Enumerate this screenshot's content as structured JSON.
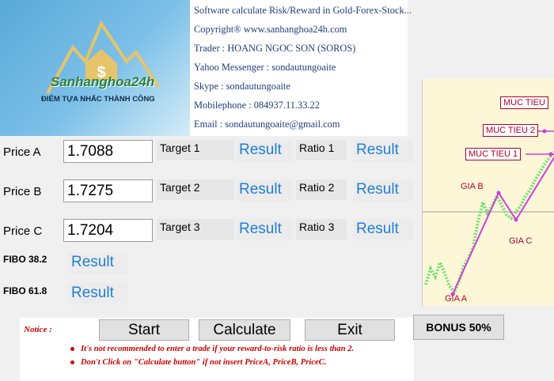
{
  "header": {
    "logo": {
      "brand": "Sanhanghoa24h",
      "slogan": "ĐIỂM TỰA NHẤC THÀNH CÔNG",
      "icon": "dollar-house-mountain-logo"
    },
    "info_lines": [
      "Software calculate Risk/Reward in  Gold-Forex-Stock...",
      "Copyright® www.sanhanghoa24h.com",
      "Trader : HOANG NGOC SON (SOROS)",
      "Yahoo Messenger : sondautungoaite",
      "Skype : sondautungoaite",
      "Mobilephone : 084937.11.33.22",
      "Email : sondautungoaite@gmail.com"
    ]
  },
  "inputs": {
    "price_a": {
      "label": "Price A",
      "value": "1.7088"
    },
    "price_b": {
      "label": "Price B",
      "value": "1.7275"
    },
    "price_c": {
      "label": "Price C",
      "value": "1.7204"
    }
  },
  "targets": [
    {
      "label": "Target 1",
      "result": "Result"
    },
    {
      "label": "Target 2",
      "result": "Result"
    },
    {
      "label": "Target 3",
      "result": "Result"
    }
  ],
  "ratios": [
    {
      "label": "Ratio 1",
      "result": "Result"
    },
    {
      "label": "Ratio 2",
      "result": "Result"
    },
    {
      "label": "Ratio 3",
      "result": "Result"
    }
  ],
  "fibo": [
    {
      "label": "FIBO 38.2",
      "result": "Result"
    },
    {
      "label": "FIBO 61.8",
      "result": "Result"
    }
  ],
  "chart": {
    "labels": {
      "muc_tieu": "MUC TIEU",
      "muc_tieu_2": "MUC TIEU 2",
      "muc_tieu_1": "MUC TIEU 1",
      "gia_a": "GIA A",
      "gia_b": "GIA B",
      "gia_c": "GIA C"
    },
    "colors": {
      "candles": "#6fe06f",
      "wave": "#d23cdc",
      "target_border": "#b0002a",
      "background": "#fdf7d8"
    }
  },
  "buttons": {
    "start": "Start",
    "calculate": "Calculate",
    "exit": "Exit",
    "bonus": "BONUS 50%"
  },
  "notice": {
    "title": "Notice :",
    "lines": [
      "It's not recommended to enter a trade if your reward-to-risk ratio is less than 2.",
      "Don't Click on \"Calculate button\" if not insert PriceA, PriceB, PriceC."
    ]
  }
}
